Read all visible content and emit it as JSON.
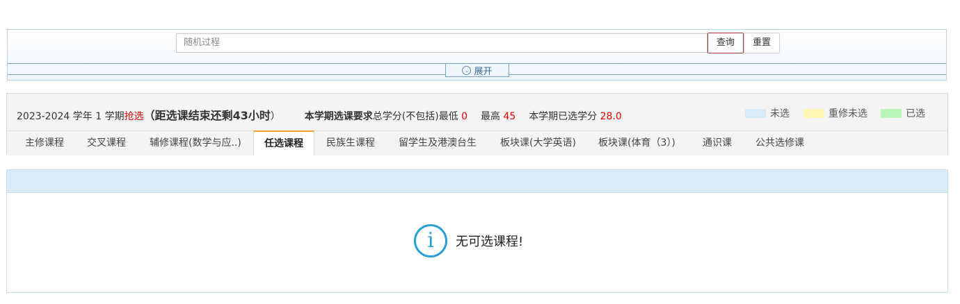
{
  "search": {
    "value": "随机过程",
    "query_label": "查询",
    "reset_label": "重置",
    "expand_label": "展开"
  },
  "info": {
    "year": "2023-2024 学年 1 学期",
    "mode": "抢选",
    "countdown_open": "（",
    "countdown": "距选课结束还剩43小时",
    "countdown_close": "）",
    "requirement_label": "本学期选课要求",
    "total_credit_label": "总学分(不包括)最低",
    "min_value": "0",
    "max_label": "最高",
    "max_value": "45",
    "selected_label": "本学期已选学分",
    "selected_value": "28.0"
  },
  "legend": [
    {
      "label": "未选",
      "color": "#d7ebf8"
    },
    {
      "label": "重修未选",
      "color": "#fff6b3"
    },
    {
      "label": "已选",
      "color": "#b8f5b8"
    }
  ],
  "tabs": [
    {
      "label": "主修课程",
      "active": false
    },
    {
      "label": "交叉课程",
      "active": false
    },
    {
      "label": "辅修课程(数学与应..)",
      "active": false
    },
    {
      "label": "任选课程",
      "active": true
    },
    {
      "label": "民族生课程",
      "active": false
    },
    {
      "label": "留学生及港澳台生",
      "active": false
    },
    {
      "label": "板块课(大学英语)",
      "active": false
    },
    {
      "label": "板块课(体育（3）)",
      "active": false
    },
    {
      "label": "通识课",
      "active": false
    },
    {
      "label": "公共选修课",
      "active": false
    }
  ],
  "result": {
    "empty_icon": "info-icon",
    "empty_message": "无可选课程!"
  }
}
